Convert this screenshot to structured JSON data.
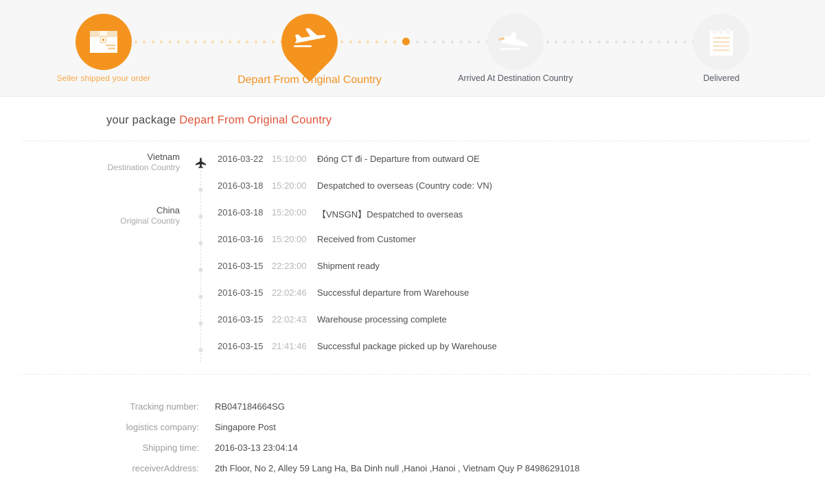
{
  "theme": {
    "accent": "#f4941f",
    "accent_soft": "#f7a94b",
    "status_red": "#e1553a",
    "band_bg": "#f7f7f7",
    "idle_circle": "#f1f1f1"
  },
  "stepper": {
    "steps": [
      {
        "label": "Seller shipped your order",
        "icon": "package-box-icon",
        "state": "done"
      },
      {
        "label": "Depart From Original Country",
        "icon": "airplane-takeoff-icon",
        "state": "current"
      },
      {
        "label": "Arrived At Destination Country",
        "icon": "airplane-landing-icon",
        "state": "pending"
      },
      {
        "label": "Delivered",
        "icon": "notepad-icon",
        "state": "pending"
      }
    ]
  },
  "headline": {
    "prefix": "your package",
    "status": "Depart From Original Country"
  },
  "timeline": {
    "rows": [
      {
        "country": "Vietnam",
        "country_sub": "Destination Country",
        "marker": "airplane-icon",
        "date": "2016-03-22",
        "time": "15:10:00",
        "description": "Đóng CT đi - Departure from outward OE"
      },
      {
        "country": "",
        "country_sub": "",
        "marker": "dot",
        "date": "2016-03-18",
        "time": "15:20:00",
        "description": "Despatched to overseas (Country code: VN)"
      },
      {
        "country": "China",
        "country_sub": "Original Country",
        "marker": "dot",
        "date": "2016-03-18",
        "time": "15:20:00",
        "description": "【VNSGN】Despatched  to overseas"
      },
      {
        "country": "",
        "country_sub": "",
        "marker": "dot",
        "date": "2016-03-16",
        "time": "15:20:00",
        "description": "Received from Customer"
      },
      {
        "country": "",
        "country_sub": "",
        "marker": "dot",
        "date": "2016-03-15",
        "time": "22:23:00",
        "description": "Shipment ready"
      },
      {
        "country": "",
        "country_sub": "",
        "marker": "dot",
        "date": "2016-03-15",
        "time": "22:02:46",
        "description": "Successful departure from Warehouse"
      },
      {
        "country": "",
        "country_sub": "",
        "marker": "dot",
        "date": "2016-03-15",
        "time": "22:02:43",
        "description": "Warehouse processing complete"
      },
      {
        "country": "",
        "country_sub": "",
        "marker": "dot",
        "date": "2016-03-15",
        "time": "21:41:46",
        "description": "Successful package picked up by Warehouse"
      }
    ]
  },
  "details": {
    "fields": [
      {
        "label": "Tracking number:",
        "value": "RB047184664SG"
      },
      {
        "label": "logistics company:",
        "value": "Singapore Post"
      },
      {
        "label": "Shipping time:",
        "value": "2016-03-13 23:04:14"
      },
      {
        "label": "receiverAddress:",
        "value": "2th Floor, No 2, Alley 59 Lang Ha, Ba Dinh null ,Hanoi ,Hanoi , Vietnam  Quy P  84986291018"
      }
    ]
  }
}
